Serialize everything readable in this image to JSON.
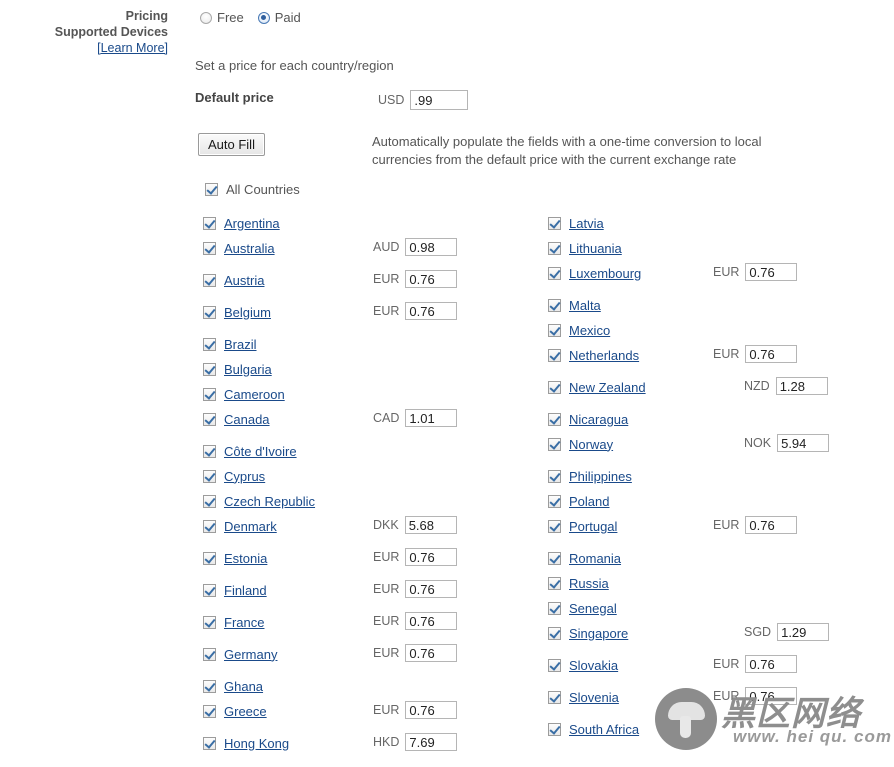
{
  "labels": {
    "pricing": "Pricing",
    "supported_devices": "Supported Devices",
    "learn_more": "[Learn More]"
  },
  "pricing_mode": {
    "options": [
      {
        "label": "Free",
        "selected": false
      },
      {
        "label": "Paid",
        "selected": true
      }
    ]
  },
  "set_price_note": "Set a price for each country/region",
  "default_price": {
    "label": "Default price",
    "currency": "USD",
    "value": ".99"
  },
  "auto_fill": {
    "button_label": "Auto Fill",
    "description": "Automatically populate the fields with a one-time conversion to local currencies from the default price with the current exchange rate"
  },
  "all_countries": {
    "label": "All Countries",
    "checked": true
  },
  "columns": {
    "left": [
      {
        "name": "Argentina",
        "checked": true,
        "currency": "",
        "price": ""
      },
      {
        "name": "Australia",
        "checked": true,
        "currency": "AUD",
        "price": "0.98"
      },
      {
        "name": "Austria",
        "checked": true,
        "currency": "EUR",
        "price": "0.76"
      },
      {
        "name": "Belgium",
        "checked": true,
        "currency": "EUR",
        "price": "0.76"
      },
      {
        "name": "Brazil",
        "checked": true,
        "currency": "",
        "price": ""
      },
      {
        "name": "Bulgaria",
        "checked": true,
        "currency": "",
        "price": ""
      },
      {
        "name": "Cameroon",
        "checked": true,
        "currency": "",
        "price": ""
      },
      {
        "name": "Canada",
        "checked": true,
        "currency": "CAD",
        "price": "1.01"
      },
      {
        "name": "Côte d'Ivoire",
        "checked": true,
        "currency": "",
        "price": ""
      },
      {
        "name": "Cyprus",
        "checked": true,
        "currency": "",
        "price": ""
      },
      {
        "name": "Czech Republic",
        "checked": true,
        "currency": "",
        "price": ""
      },
      {
        "name": "Denmark",
        "checked": true,
        "currency": "DKK",
        "price": "5.68"
      },
      {
        "name": "Estonia",
        "checked": true,
        "currency": "EUR",
        "price": "0.76"
      },
      {
        "name": "Finland",
        "checked": true,
        "currency": "EUR",
        "price": "0.76"
      },
      {
        "name": "France",
        "checked": true,
        "currency": "EUR",
        "price": "0.76"
      },
      {
        "name": "Germany",
        "checked": true,
        "currency": "EUR",
        "price": "0.76"
      },
      {
        "name": "Ghana",
        "checked": true,
        "currency": "",
        "price": ""
      },
      {
        "name": "Greece",
        "checked": true,
        "currency": "EUR",
        "price": "0.76"
      },
      {
        "name": "Hong Kong",
        "checked": true,
        "currency": "HKD",
        "price": "7.69"
      }
    ],
    "right": [
      {
        "name": "Latvia",
        "checked": true,
        "currency": "",
        "price": ""
      },
      {
        "name": "Lithuania",
        "checked": true,
        "currency": "",
        "price": ""
      },
      {
        "name": "Luxembourg",
        "checked": true,
        "currency": "EUR",
        "price": "0.76"
      },
      {
        "name": "Malta",
        "checked": true,
        "currency": "",
        "price": ""
      },
      {
        "name": "Mexico",
        "checked": true,
        "currency": "",
        "price": ""
      },
      {
        "name": "Netherlands",
        "checked": true,
        "currency": "EUR",
        "price": "0.76"
      },
      {
        "name": "New Zealand",
        "checked": true,
        "currency": "NZD",
        "price": "1.28"
      },
      {
        "name": "Nicaragua",
        "checked": true,
        "currency": "",
        "price": ""
      },
      {
        "name": "Norway",
        "checked": true,
        "currency": "NOK",
        "price": "5.94"
      },
      {
        "name": "Philippines",
        "checked": true,
        "currency": "",
        "price": ""
      },
      {
        "name": "Poland",
        "checked": true,
        "currency": "",
        "price": ""
      },
      {
        "name": "Portugal",
        "checked": true,
        "currency": "EUR",
        "price": "0.76"
      },
      {
        "name": "Romania",
        "checked": true,
        "currency": "",
        "price": ""
      },
      {
        "name": "Russia",
        "checked": true,
        "currency": "",
        "price": ""
      },
      {
        "name": "Senegal",
        "checked": true,
        "currency": "",
        "price": ""
      },
      {
        "name": "Singapore",
        "checked": true,
        "currency": "SGD",
        "price": "1.29"
      },
      {
        "name": "Slovakia",
        "checked": true,
        "currency": "EUR",
        "price": "0.76"
      },
      {
        "name": "Slovenia",
        "checked": true,
        "currency": "EUR",
        "price": "0.76"
      },
      {
        "name": "South Africa",
        "checked": true,
        "currency": "",
        "price": ""
      }
    ]
  },
  "watermark": {
    "cn_text": "黑区网络",
    "url_text": "www. hei qu. com"
  },
  "colors": {
    "link": "#1a4a8a",
    "text": "#555555",
    "input_border": "#b5b5b5",
    "watermark": "#8e8e8e"
  }
}
